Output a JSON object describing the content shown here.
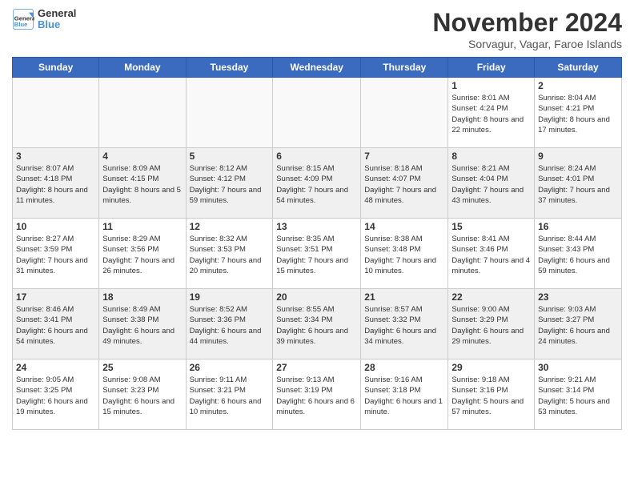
{
  "header": {
    "logo_line1": "General",
    "logo_line2": "Blue",
    "month_title": "November 2024",
    "location": "Sorvagur, Vagar, Faroe Islands"
  },
  "weekdays": [
    "Sunday",
    "Monday",
    "Tuesday",
    "Wednesday",
    "Thursday",
    "Friday",
    "Saturday"
  ],
  "weeks": [
    [
      {
        "day": "",
        "info": ""
      },
      {
        "day": "",
        "info": ""
      },
      {
        "day": "",
        "info": ""
      },
      {
        "day": "",
        "info": ""
      },
      {
        "day": "",
        "info": ""
      },
      {
        "day": "1",
        "info": "Sunrise: 8:01 AM\nSunset: 4:24 PM\nDaylight: 8 hours and 22 minutes."
      },
      {
        "day": "2",
        "info": "Sunrise: 8:04 AM\nSunset: 4:21 PM\nDaylight: 8 hours and 17 minutes."
      }
    ],
    [
      {
        "day": "3",
        "info": "Sunrise: 8:07 AM\nSunset: 4:18 PM\nDaylight: 8 hours and 11 minutes."
      },
      {
        "day": "4",
        "info": "Sunrise: 8:09 AM\nSunset: 4:15 PM\nDaylight: 8 hours and 5 minutes."
      },
      {
        "day": "5",
        "info": "Sunrise: 8:12 AM\nSunset: 4:12 PM\nDaylight: 7 hours and 59 minutes."
      },
      {
        "day": "6",
        "info": "Sunrise: 8:15 AM\nSunset: 4:09 PM\nDaylight: 7 hours and 54 minutes."
      },
      {
        "day": "7",
        "info": "Sunrise: 8:18 AM\nSunset: 4:07 PM\nDaylight: 7 hours and 48 minutes."
      },
      {
        "day": "8",
        "info": "Sunrise: 8:21 AM\nSunset: 4:04 PM\nDaylight: 7 hours and 43 minutes."
      },
      {
        "day": "9",
        "info": "Sunrise: 8:24 AM\nSunset: 4:01 PM\nDaylight: 7 hours and 37 minutes."
      }
    ],
    [
      {
        "day": "10",
        "info": "Sunrise: 8:27 AM\nSunset: 3:59 PM\nDaylight: 7 hours and 31 minutes."
      },
      {
        "day": "11",
        "info": "Sunrise: 8:29 AM\nSunset: 3:56 PM\nDaylight: 7 hours and 26 minutes."
      },
      {
        "day": "12",
        "info": "Sunrise: 8:32 AM\nSunset: 3:53 PM\nDaylight: 7 hours and 20 minutes."
      },
      {
        "day": "13",
        "info": "Sunrise: 8:35 AM\nSunset: 3:51 PM\nDaylight: 7 hours and 15 minutes."
      },
      {
        "day": "14",
        "info": "Sunrise: 8:38 AM\nSunset: 3:48 PM\nDaylight: 7 hours and 10 minutes."
      },
      {
        "day": "15",
        "info": "Sunrise: 8:41 AM\nSunset: 3:46 PM\nDaylight: 7 hours and 4 minutes."
      },
      {
        "day": "16",
        "info": "Sunrise: 8:44 AM\nSunset: 3:43 PM\nDaylight: 6 hours and 59 minutes."
      }
    ],
    [
      {
        "day": "17",
        "info": "Sunrise: 8:46 AM\nSunset: 3:41 PM\nDaylight: 6 hours and 54 minutes."
      },
      {
        "day": "18",
        "info": "Sunrise: 8:49 AM\nSunset: 3:38 PM\nDaylight: 6 hours and 49 minutes."
      },
      {
        "day": "19",
        "info": "Sunrise: 8:52 AM\nSunset: 3:36 PM\nDaylight: 6 hours and 44 minutes."
      },
      {
        "day": "20",
        "info": "Sunrise: 8:55 AM\nSunset: 3:34 PM\nDaylight: 6 hours and 39 minutes."
      },
      {
        "day": "21",
        "info": "Sunrise: 8:57 AM\nSunset: 3:32 PM\nDaylight: 6 hours and 34 minutes."
      },
      {
        "day": "22",
        "info": "Sunrise: 9:00 AM\nSunset: 3:29 PM\nDaylight: 6 hours and 29 minutes."
      },
      {
        "day": "23",
        "info": "Sunrise: 9:03 AM\nSunset: 3:27 PM\nDaylight: 6 hours and 24 minutes."
      }
    ],
    [
      {
        "day": "24",
        "info": "Sunrise: 9:05 AM\nSunset: 3:25 PM\nDaylight: 6 hours and 19 minutes."
      },
      {
        "day": "25",
        "info": "Sunrise: 9:08 AM\nSunset: 3:23 PM\nDaylight: 6 hours and 15 minutes."
      },
      {
        "day": "26",
        "info": "Sunrise: 9:11 AM\nSunset: 3:21 PM\nDaylight: 6 hours and 10 minutes."
      },
      {
        "day": "27",
        "info": "Sunrise: 9:13 AM\nSunset: 3:19 PM\nDaylight: 6 hours and 6 minutes."
      },
      {
        "day": "28",
        "info": "Sunrise: 9:16 AM\nSunset: 3:18 PM\nDaylight: 6 hours and 1 minute."
      },
      {
        "day": "29",
        "info": "Sunrise: 9:18 AM\nSunset: 3:16 PM\nDaylight: 5 hours and 57 minutes."
      },
      {
        "day": "30",
        "info": "Sunrise: 9:21 AM\nSunset: 3:14 PM\nDaylight: 5 hours and 53 minutes."
      }
    ]
  ]
}
